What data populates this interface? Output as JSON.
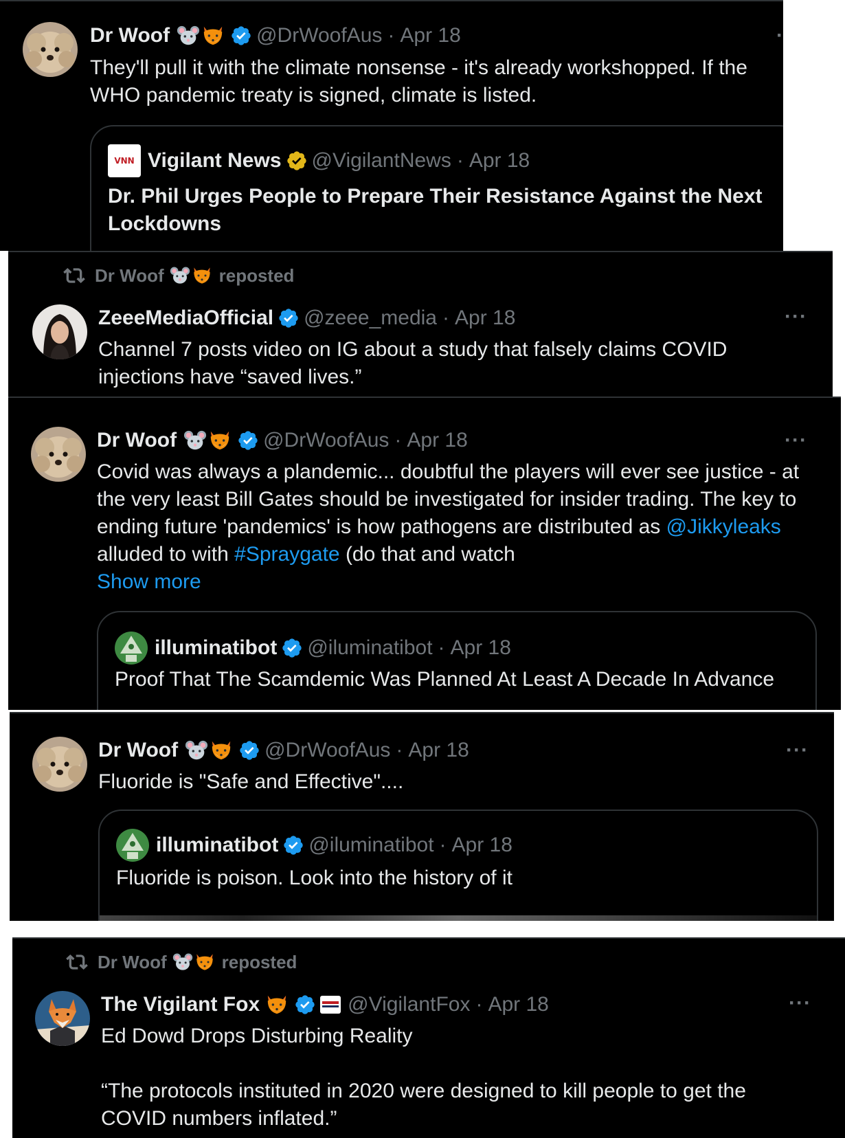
{
  "posts": [
    {
      "name": "Dr Woof",
      "handle": "@DrWoofAus",
      "dot": "·",
      "date": "Apr 18",
      "text": "They'll pull it with the climate nonsense - it's already workshopped. If the WHO pandemic treaty is signed, climate is listed.",
      "quote": {
        "name": "Vigilant News",
        "handle": "@VigilantNews",
        "date": "Apr 18",
        "title": "Dr. Phil Urges People to Prepare Their Resistance Against the Next Lockdowns",
        "logo_text": "VNN"
      }
    },
    {
      "repost_by": "Dr Woof",
      "repost_label": "reposted",
      "name": "ZeeeMediaOfficial",
      "handle": "@zeee_media",
      "dot": "·",
      "date": "Apr 18",
      "text": "Channel 7 posts video on IG about a study that falsely claims COVID injections have “saved lives.”"
    },
    {
      "name": "Dr Woof",
      "handle": "@DrWoofAus",
      "dot": "·",
      "date": "Apr 18",
      "text_before": "Covid was always a plandemic... doubtful the players will ever see justice - at the very least Bill Gates should be investigated for insider trading. The key to ending future 'pandemics' is how pathogens are distributed as",
      "mention": "@Jikkyleaks",
      "text_middle": "alluded to with",
      "hashtag": "#Spraygate",
      "text_after": "(do that and watch",
      "show_more": "Show more",
      "quote": {
        "name": "illuminatibot",
        "handle": "@iluminatibot",
        "date": "Apr 18",
        "text": "Proof That The Scamdemic Was Planned At Least A Decade In Advance"
      }
    },
    {
      "name": "Dr Woof",
      "handle": "@DrWoofAus",
      "dot": "·",
      "date": "Apr 18",
      "text": "Fluoride is \"Safe and Effective\"....",
      "quote": {
        "name": "illuminatibot",
        "handle": "@iluminatibot",
        "date": "Apr 18",
        "text": "Fluoride is poison. Look into the history of it"
      }
    },
    {
      "repost_by": "Dr Woof",
      "repost_label": "reposted",
      "name": "The Vigilant Fox",
      "handle": "@VigilantFox",
      "dot": "·",
      "date": "Apr 18",
      "text_line1": "Ed Dowd Drops Disturbing Reality",
      "text_line2": "“The protocols instituted in 2020 were designed to kill people to get the COVID numbers inflated.”"
    }
  ],
  "more_icon": "···",
  "colors": {
    "background": "#000000",
    "text": "#e7e9ea",
    "secondary": "#71767b",
    "link": "#1d9bf0",
    "verified_blue": "#1d9bf0",
    "verified_gold": "#e2b719",
    "border": "#2f3336"
  }
}
